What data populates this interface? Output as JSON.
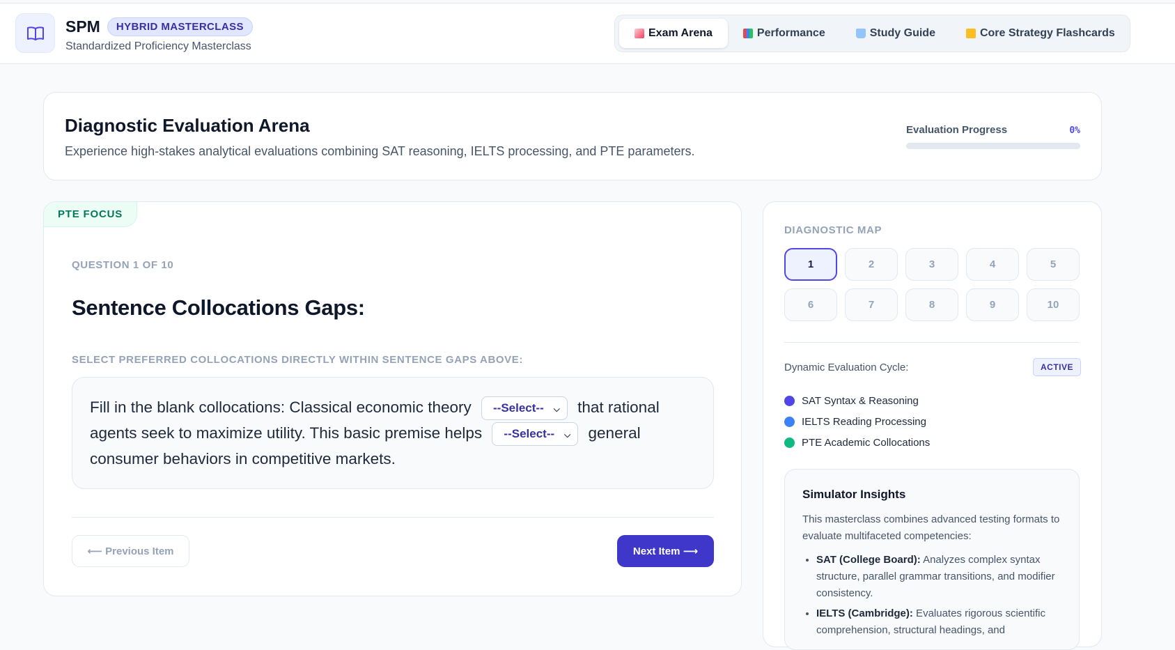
{
  "header": {
    "brand": "SPM",
    "badge": "HYBRID MASTERCLASS",
    "subtitle": "Standardized Proficiency Masterclass",
    "logo_icon": "book-open-icon",
    "tabs": [
      {
        "label": "Exam Arena",
        "icon": "memo-icon",
        "active": true
      },
      {
        "label": "Performance",
        "icon": "bar-chart-icon",
        "active": false
      },
      {
        "label": "Study Guide",
        "icon": "open-book-icon",
        "active": false
      },
      {
        "label": "Core Strategy Flashcards",
        "icon": "folder-icon",
        "active": false
      }
    ]
  },
  "hero": {
    "title": "Diagnostic Evaluation Arena",
    "description": "Experience high-stakes analytical evaluations combining SAT reasoning, IELTS processing, and PTE parameters.",
    "progress_label": "Evaluation Progress",
    "progress_value": "0%",
    "progress_fraction": 0
  },
  "question": {
    "focus_tag": "PTE FOCUS",
    "number_label": "QUESTION 1 OF 10",
    "title": "Sentence Collocations Gaps:",
    "instruction": "SELECT PREFERRED COLLOCATIONS DIRECTLY WITHIN SENTENCE GAPS ABOVE:",
    "passage_part1": "Fill in the blank collocations: Classical economic theory",
    "select1": "--Select--",
    "passage_part2": "that rational agents seek to maximize utility. This basic premise helps",
    "select2": "--Select--",
    "passage_part3": "general consumer behaviors in competitive markets.",
    "prev_label": "⟵ Previous Item",
    "next_label": "Next Item ⟶"
  },
  "side": {
    "map_title": "DIAGNOSTIC MAP",
    "map_cells": [
      "1",
      "2",
      "3",
      "4",
      "5",
      "6",
      "7",
      "8",
      "9",
      "10"
    ],
    "cycle_label": "Dynamic Evaluation Cycle:",
    "cycle_status": "ACTIVE",
    "legend": [
      {
        "label": "SAT Syntax & Reasoning",
        "color": "#4f46e5"
      },
      {
        "label": "IELTS Reading Processing",
        "color": "#3b82f6"
      },
      {
        "label": "PTE Academic Collocations",
        "color": "#10b981"
      }
    ],
    "insights_title": "Simulator Insights",
    "insights_text": "This masterclass combines advanced testing formats to evaluate multifaceted competencies:",
    "insights_items": [
      {
        "bold": "SAT (College Board):",
        "text": " Analyzes complex syntax structure, parallel grammar transitions, and modifier consistency."
      },
      {
        "bold": "IELTS (Cambridge):",
        "text": " Evaluates rigorous scientific comprehension, structural headings, and"
      }
    ]
  },
  "colors": {
    "accent": "#4f46e5",
    "primary_button": "#3f37c9",
    "pte_green": "#047857"
  }
}
